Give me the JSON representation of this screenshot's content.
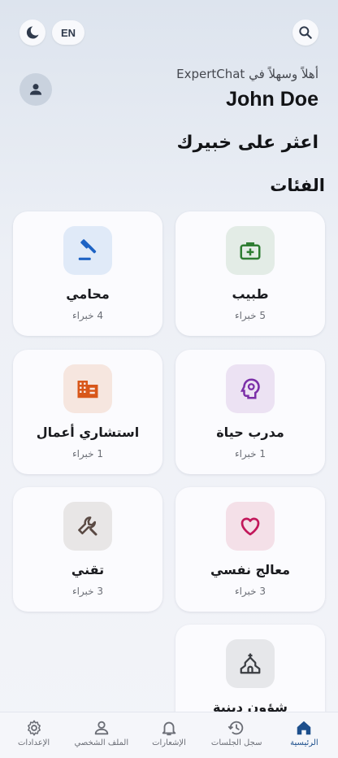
{
  "header": {
    "lang_label": "EN",
    "welcome": "أهلاً وسهلاً في ExpertChat",
    "username": "John Doe"
  },
  "headline": "اعثر على خبيرك",
  "categories_title": "الفئات",
  "categories": [
    {
      "name": "طبيب",
      "count": "5 خبراء",
      "icon": "medical-bag-icon",
      "color": "#2e7d32",
      "bg": "#e3ece6"
    },
    {
      "name": "محامي",
      "count": "4 خبراء",
      "icon": "gavel-icon",
      "color": "#1e63c4",
      "bg": "#e0eaf8"
    },
    {
      "name": "مدرب حياة",
      "count": "1 خبراء",
      "icon": "psychology-icon",
      "color": "#7b2fa8",
      "bg": "#ece2f3"
    },
    {
      "name": "استشاري أعمال",
      "count": "1 خبراء",
      "icon": "business-building-icon",
      "color": "#d8571a",
      "bg": "#f6e6df"
    },
    {
      "name": "معالج نفسي",
      "count": "3 خبراء",
      "icon": "heart-icon",
      "color": "#c2185b",
      "bg": "#f4e0e8"
    },
    {
      "name": "تقني",
      "count": "3 خبراء",
      "icon": "wrench-icon",
      "color": "#5a4a44",
      "bg": "#e8e6e6"
    },
    {
      "name": "شؤون دينية",
      "count": "",
      "icon": "church-icon",
      "color": "#3a3d42",
      "bg": "#e6e7ea"
    }
  ],
  "nav": [
    {
      "label": "الرئيسية",
      "icon": "home-icon",
      "active": true
    },
    {
      "label": "سجل الجلسات",
      "icon": "history-icon",
      "active": false
    },
    {
      "label": "الإشعارات",
      "icon": "bell-icon",
      "active": false
    },
    {
      "label": "الملف الشخصي",
      "icon": "person-icon",
      "active": false
    },
    {
      "label": "الإعدادات",
      "icon": "settings-icon",
      "active": false
    }
  ],
  "colors": {
    "accent": "#1d4f8c",
    "card_bg": "#fbfbfe"
  }
}
